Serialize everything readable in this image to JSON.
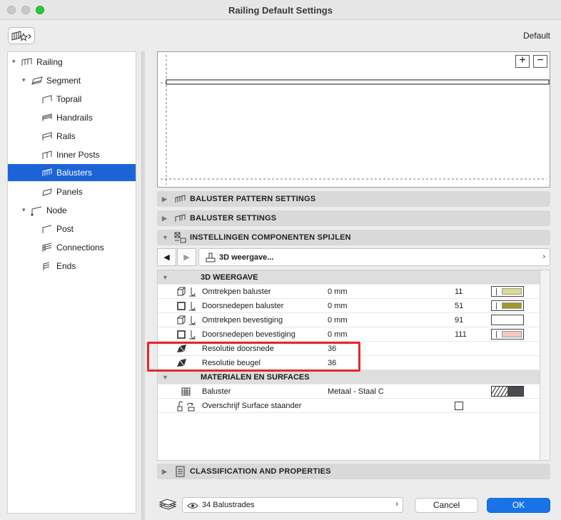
{
  "window": {
    "title": "Railing Default Settings",
    "preset_label": "Default"
  },
  "tree": [
    {
      "label": "Railing",
      "icon": "railing-icon",
      "level": 0,
      "expanded": true
    },
    {
      "label": "Segment",
      "icon": "segment-icon",
      "level": 1,
      "expanded": true
    },
    {
      "label": "Toprail",
      "icon": "toprail-icon",
      "level": 2
    },
    {
      "label": "Handrails",
      "icon": "handrails-icon",
      "level": 2
    },
    {
      "label": "Rails",
      "icon": "rails-icon",
      "level": 2
    },
    {
      "label": "Inner Posts",
      "icon": "inner-posts-icon",
      "level": 2
    },
    {
      "label": "Balusters",
      "icon": "balusters-icon",
      "level": 2,
      "selected": true
    },
    {
      "label": "Panels",
      "icon": "panels-icon",
      "level": 2
    },
    {
      "label": "Node",
      "icon": "node-icon",
      "level": 1,
      "expanded": true
    },
    {
      "label": "Post",
      "icon": "post-icon",
      "level": 2
    },
    {
      "label": "Connections",
      "icon": "connections-icon",
      "level": 2
    },
    {
      "label": "Ends",
      "icon": "ends-icon",
      "level": 2
    }
  ],
  "sections": {
    "pattern": "BALUSTER PATTERN SETTINGS",
    "settings": "BALUSTER SETTINGS",
    "components": "INSTELLINGEN COMPONENTEN SPIJLEN",
    "classification": "CLASSIFICATION AND PROPERTIES"
  },
  "nav": {
    "dropdown": "3D weergave..."
  },
  "table": {
    "group1": "3D WEERGAVE",
    "rows1": [
      {
        "label": "Omtrekpen baluster",
        "value": "0 mm",
        "num": "11",
        "swatch": "#d9dc8f"
      },
      {
        "label": "Doorsnedepen baluster",
        "value": "0 mm",
        "num": "51",
        "swatch": "#9c9a2e"
      },
      {
        "label": "Omtrekpen bevestiging",
        "value": "0 mm",
        "num": "91",
        "swatch": ""
      },
      {
        "label": "Doorsnedepen bevestiging",
        "value": "0 mm",
        "num": "111",
        "swatch": "#f6c8c4"
      },
      {
        "label": "Resolutie doorsnede",
        "value": "36"
      },
      {
        "label": "Resolutie beugel",
        "value": "36"
      }
    ],
    "group2": "MATERIALEN EN SURFACES",
    "rows2": [
      {
        "label": "Baluster",
        "value": "Metaal - Staal C"
      },
      {
        "label": "Overschrijf Surface staander"
      }
    ]
  },
  "footer": {
    "layer": "34 Balustrades",
    "cancel": "Cancel",
    "ok": "OK"
  },
  "colors": {
    "accent": "#1873e8",
    "selection": "#1d63d8",
    "highlight": "#e6262a"
  }
}
